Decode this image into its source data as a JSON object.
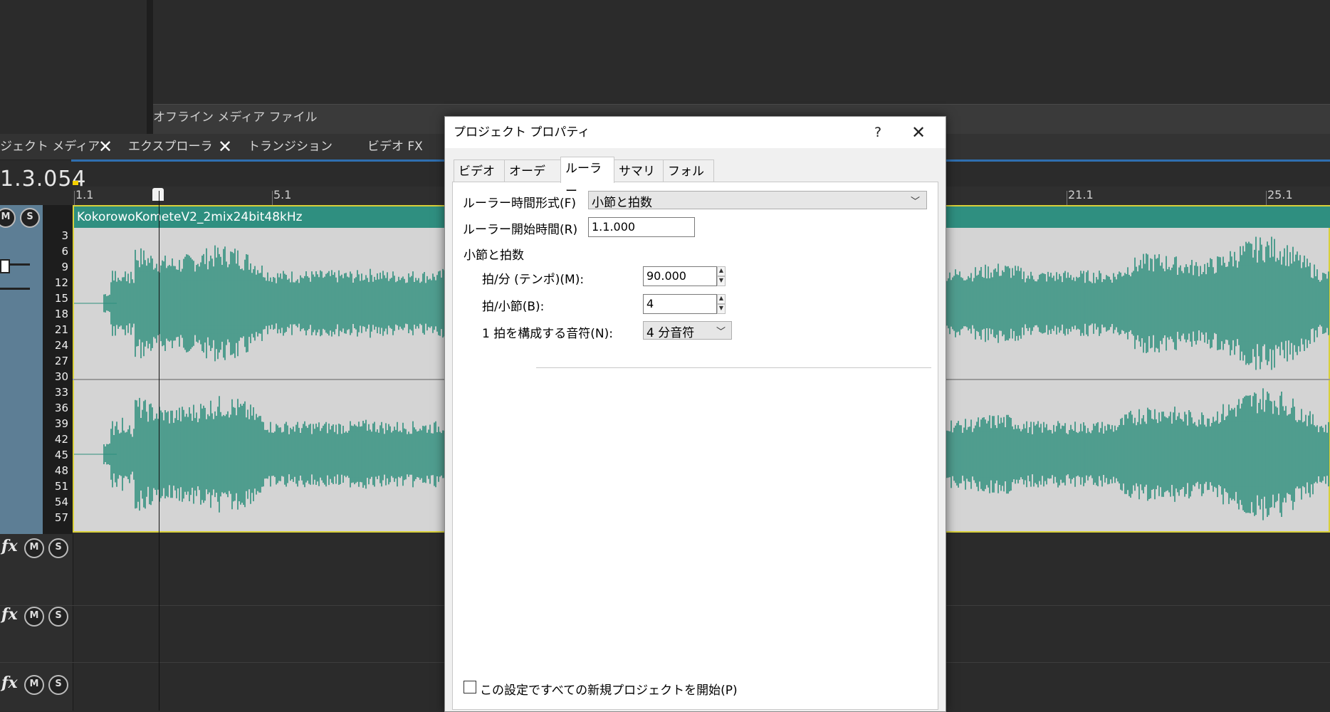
{
  "editor": {
    "offline_media_label": "オフライン メディア ファイル",
    "tabs": [
      {
        "label": "ジェクト メディア"
      },
      {
        "label": "エクスプローラ"
      },
      {
        "label": "トランジション"
      },
      {
        "label": "ビデオ FX"
      }
    ],
    "close_glyph": "✕",
    "time_display": "1.3.054",
    "ruler_labels": [
      "1.1",
      "5.1",
      "21.1",
      "25.1"
    ],
    "meter_levels": [
      "3",
      "6",
      "9",
      "12",
      "15",
      "18",
      "21",
      "24",
      "27",
      "30",
      "33",
      "36",
      "39",
      "42",
      "45",
      "48",
      "51",
      "54",
      "57"
    ],
    "clip_name": "KokorowoKometeV2_2mix24bit48kHz",
    "track_buttons": {
      "fx": "fx",
      "mute": "M",
      "solo": "S"
    },
    "colors": {
      "clip_header": "#2f8f80",
      "waveform": "#2e8f7d",
      "track_header": "#5d7e95",
      "selection": "#d9d03a"
    }
  },
  "dialog": {
    "title": "プロジェクト プロパティ",
    "help": "?",
    "close": "✕",
    "tabs": [
      {
        "label": "ビデオ",
        "active": false
      },
      {
        "label": "オーディオ",
        "active": false
      },
      {
        "label": "ルーラー",
        "active": true
      },
      {
        "label": "サマリー",
        "active": false
      },
      {
        "label": "フォルダ",
        "active": false
      }
    ],
    "ruler_format_label": "ルーラー時間形式(F)",
    "ruler_format_value": "小節と拍数",
    "ruler_start_label": "ルーラー開始時間(R)",
    "ruler_start_value": "1.1.000",
    "group_label": "小節と拍数",
    "tempo_label": "拍/分 (テンポ)(M):",
    "tempo_value": "90.000",
    "beats_label": "拍/小節(B):",
    "beats_value": "4",
    "note_label": "1 拍を構成する音符(N):",
    "note_value": "4 分音符",
    "start_all_label": "この設定ですべての新規プロジェクトを開始(P)",
    "start_all_checked": false
  }
}
